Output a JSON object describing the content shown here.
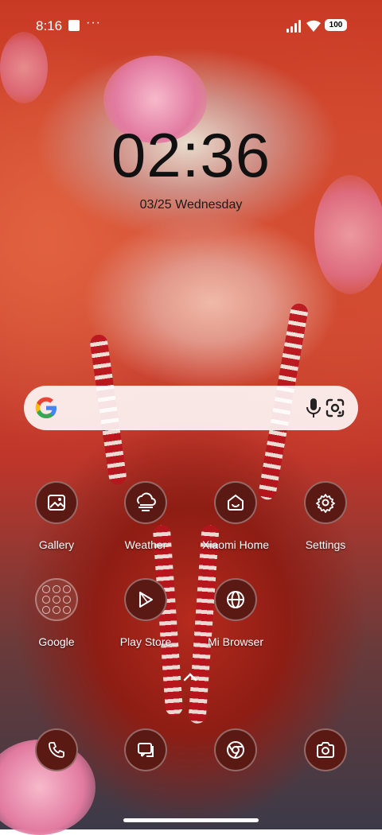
{
  "status_bar": {
    "time": "8:16",
    "overflow": "···",
    "battery": "100",
    "icons": [
      "notification-square-icon",
      "cellular-signal-icon",
      "wifi-icon",
      "battery-icon"
    ]
  },
  "lockclock": {
    "time": "02:36",
    "date": "03/25 Wednesday"
  },
  "search_bar": {
    "icons": [
      "google-g-icon",
      "microphone-icon",
      "google-lens-icon"
    ]
  },
  "apps": [
    {
      "label": "Gallery",
      "icon": "gallery-icon"
    },
    {
      "label": "Weather",
      "icon": "weather-icon"
    },
    {
      "label": "Xiaomi Home",
      "icon": "xiaomi-home-icon"
    },
    {
      "label": "Settings",
      "icon": "gear-icon"
    },
    {
      "label": "Google",
      "icon": "google-folder-icon"
    },
    {
      "label": "Play Store",
      "icon": "play-store-icon"
    },
    {
      "label": "Mi Browser",
      "icon": "globe-icon"
    }
  ],
  "dock": [
    {
      "icon": "phone-icon"
    },
    {
      "icon": "messages-icon"
    },
    {
      "icon": "chrome-icon"
    },
    {
      "icon": "camera-icon"
    }
  ],
  "colors": {
    "icon_bg": "#5b1914",
    "clock_text": "#111111"
  }
}
